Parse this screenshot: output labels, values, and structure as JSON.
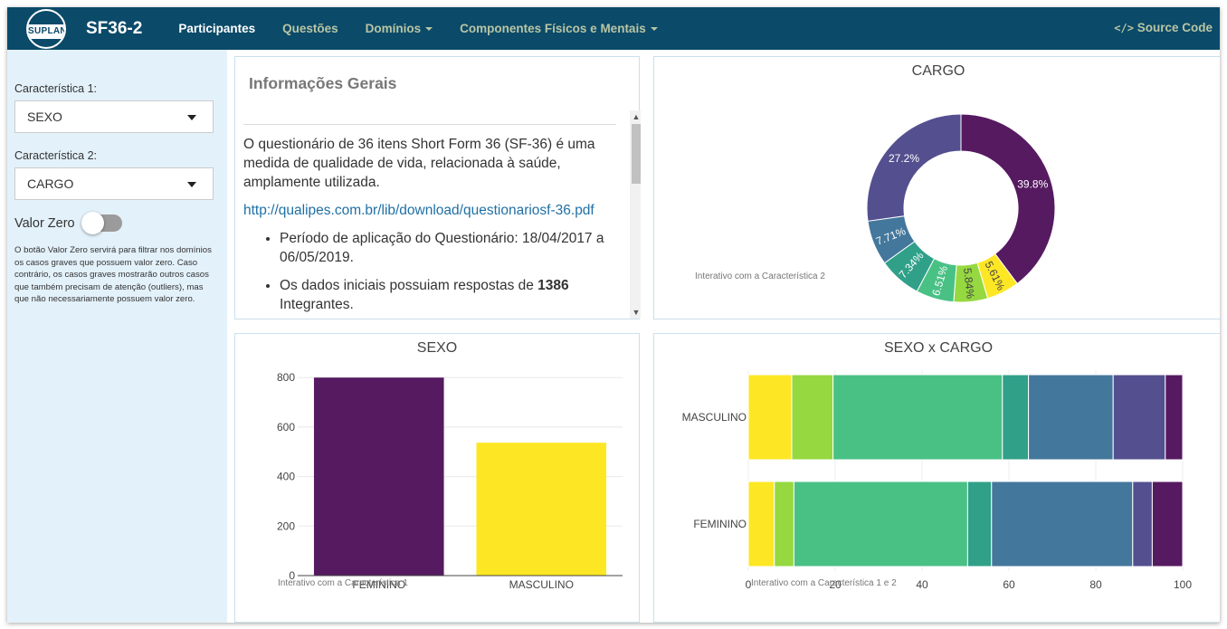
{
  "navbar": {
    "logo_text": "SUPLAN",
    "brand": "SF36-2",
    "items": [
      {
        "label": "Participantes",
        "active": true,
        "dropdown": false
      },
      {
        "label": "Questões",
        "active": false,
        "dropdown": false
      },
      {
        "label": "Domínios",
        "active": false,
        "dropdown": true
      },
      {
        "label": "Componentes Físicos e Mentais",
        "active": false,
        "dropdown": true
      }
    ],
    "source_code": "Source Code",
    "source_icon": "code-icon"
  },
  "sidebar": {
    "char1_label": "Característica 1:",
    "char1_value": "SEXO",
    "char2_label": "Característica 2:",
    "char2_value": "CARGO",
    "valor_zero_label": "Valor Zero",
    "valor_zero_on": false,
    "valor_zero_desc": "O botão Valor Zero servirá para filtrar nos domínios os casos graves que possuem valor zero. Caso contrário, os casos graves mostrarão outros casos que também precisam de atenção (outliers), mas que não necessariamente possuem valor zero."
  },
  "info": {
    "title": "Informações Gerais",
    "paragraph": "O questionário de 36 itens Short Form 36 (SF-36) é uma medida de qualidade de vida, relacionada à saúde, amplamente utilizada.",
    "link": "http://qualipes.com.br/lib/download/questionariosf-36.pdf",
    "bullet1": "Período de aplicação do Questionário: 18/04/2017 a 06/05/2019.",
    "bullet2_pre": "Os dados iniciais possuiam respostas de ",
    "bullet2_bold": "1386",
    "bullet2_post": " Integrantes."
  },
  "colors": {
    "navbar": "#0b4a69",
    "sidebar": "#e3f1fa",
    "viridis": [
      "#fde725",
      "#95d840",
      "#49c185",
      "#30a089",
      "#43779c",
      "#544f8f",
      "#561a61"
    ]
  },
  "chart_data": [
    {
      "type": "pie",
      "title": "CARGO",
      "hole": true,
      "labels": [
        "39.8%",
        "5.61%",
        "5.84%",
        "6.51%",
        "7.34%",
        "7.71%",
        "27.2%"
      ],
      "values": [
        39.8,
        5.61,
        5.84,
        6.51,
        7.34,
        7.71,
        27.2
      ],
      "colors": [
        "#561a61",
        "#fde725",
        "#95d840",
        "#49c185",
        "#30a089",
        "#43779c",
        "#544f8f"
      ],
      "annotation": "Interativo com a Característica 2"
    },
    {
      "type": "bar",
      "title": "SEXO",
      "categories": [
        "FEMININO",
        "MASCULINO"
      ],
      "values": [
        800,
        537
      ],
      "colors": [
        "#561a61",
        "#fde725"
      ],
      "ylim": [
        0,
        830
      ],
      "yticks": [
        0,
        200,
        400,
        600,
        800
      ],
      "annotation": "Interativo com a Característica 1"
    },
    {
      "type": "bar",
      "orientation": "horizontal",
      "stacked": true,
      "title": "SEXO x CARGO",
      "categories": [
        "MASCULINO",
        "FEMININO"
      ],
      "series": [
        {
          "color": "#fde725",
          "values": [
            10,
            6
          ]
        },
        {
          "color": "#95d840",
          "values": [
            9.5,
            4.5
          ]
        },
        {
          "color": "#49c185",
          "values": [
            39,
            40
          ]
        },
        {
          "color": "#30a089",
          "values": [
            6,
            5.5
          ]
        },
        {
          "color": "#43779c",
          "values": [
            19.5,
            32.5
          ]
        },
        {
          "color": "#544f8f",
          "values": [
            12,
            4.5
          ]
        },
        {
          "color": "#561a61",
          "values": [
            4,
            7
          ]
        }
      ],
      "xlim": [
        0,
        100
      ],
      "xticks": [
        0,
        20,
        40,
        60,
        80,
        100
      ],
      "annotation": "Interativo com a Característica 1 e 2"
    }
  ]
}
